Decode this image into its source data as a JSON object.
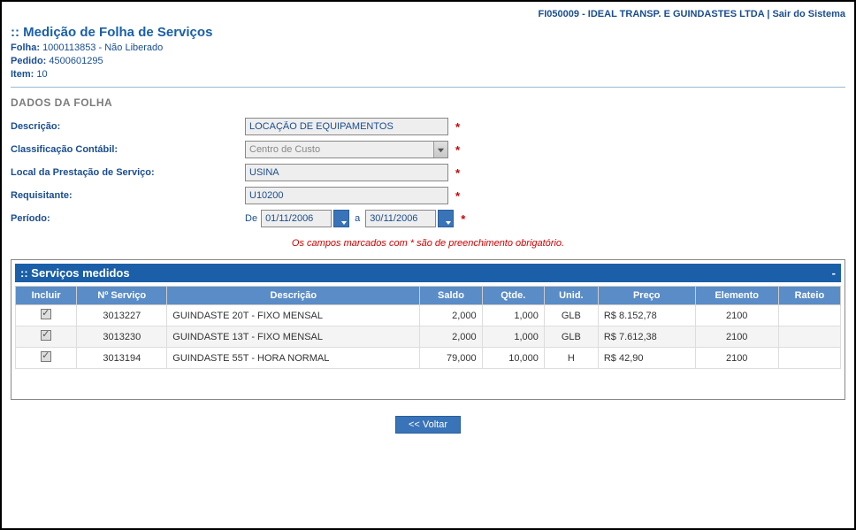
{
  "header": {
    "company_code": "FI050009",
    "company_name": "IDEAL TRANSP. E GUINDASTES LTDA",
    "logout_label": "Sair do Sistema"
  },
  "page": {
    "title_prefix": "::",
    "title": "Medição de Folha de Serviços",
    "folha_label": "Folha:",
    "folha_value": "1000113853",
    "folha_status": "- Não Liberado",
    "pedido_label": "Pedido:",
    "pedido_value": "4500601295",
    "item_label": "Item:",
    "item_value": "10"
  },
  "section_heading": "DADOS DA FOLHA",
  "form": {
    "descricao_label": "Descrição:",
    "descricao_value": "LOCAÇÃO DE EQUIPAMENTOS",
    "classif_label": "Classificação Contábil:",
    "classif_value": "Centro de Custo",
    "local_label": "Local da Prestação de Serviço:",
    "local_value": "USINA",
    "requisitante_label": "Requisitante:",
    "requisitante_value": "U10200",
    "periodo_label": "Período:",
    "periodo_de_label": "De",
    "periodo_de_value": "01/11/2006",
    "periodo_a_label": "a",
    "periodo_a_value": "30/11/2006"
  },
  "required_note": "Os campos marcados com * são de preenchimento obrigatório.",
  "table": {
    "title_prefix": ":: ",
    "title": "Serviços medidos",
    "columns": {
      "incluir": "Incluir",
      "num_servico": "Nº Serviço",
      "descricao": "Descrição",
      "saldo": "Saldo",
      "qtde": "Qtde.",
      "unid": "Unid.",
      "preco": "Preço",
      "elemento": "Elemento",
      "rateio": "Rateio"
    },
    "rows": [
      {
        "incluir": true,
        "num": "3013227",
        "desc": "GUINDASTE 20T - FIXO MENSAL",
        "saldo": "2,000",
        "qtde": "1,000",
        "unid": "GLB",
        "preco": "R$ 8.152,78",
        "elemento": "2100",
        "rateio": ""
      },
      {
        "incluir": true,
        "num": "3013230",
        "desc": "GUINDASTE 13T - FIXO MENSAL",
        "saldo": "2,000",
        "qtde": "1,000",
        "unid": "GLB",
        "preco": "R$ 7.612,38",
        "elemento": "2100",
        "rateio": ""
      },
      {
        "incluir": true,
        "num": "3013194",
        "desc": "GUINDASTE 55T - HORA NORMAL",
        "saldo": "79,000",
        "qtde": "10,000",
        "unid": "H",
        "preco": "R$ 42,90",
        "elemento": "2100",
        "rateio": ""
      }
    ]
  },
  "buttons": {
    "voltar": "<< Voltar"
  }
}
